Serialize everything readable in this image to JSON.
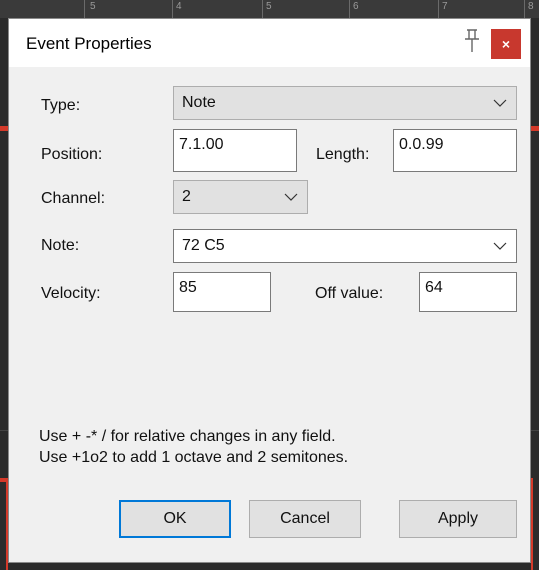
{
  "ruler": {
    "labels": [
      "5",
      "4",
      "5",
      "6",
      "7",
      "8"
    ]
  },
  "dialog": {
    "title": "Event Properties",
    "close_symbol": "×",
    "icons": {
      "pin": "pin-icon",
      "close": "close-icon",
      "chevron": "chevron-down-icon"
    }
  },
  "form": {
    "type": {
      "label": "Type:",
      "value": "Note"
    },
    "position": {
      "label": "Position:",
      "value": "7.1.00"
    },
    "length": {
      "label": "Length:",
      "value": "0.0.99"
    },
    "channel": {
      "label": "Channel:",
      "value": "2"
    },
    "note": {
      "label": "Note:",
      "value": "72 C5"
    },
    "velocity": {
      "label": "Velocity:",
      "value": "85"
    },
    "off_value": {
      "label": "Off value:",
      "value": "64"
    }
  },
  "hints": [
    "Use + -* / for relative changes in any field.",
    "Use +1o2  to add 1 octave and 2 semitones."
  ],
  "buttons": {
    "ok": "OK",
    "cancel": "Cancel",
    "apply": "Apply"
  },
  "colors": {
    "close_button": "#c8382e",
    "default_button_border": "#0078d7",
    "track_accent": "#d43a2a"
  }
}
